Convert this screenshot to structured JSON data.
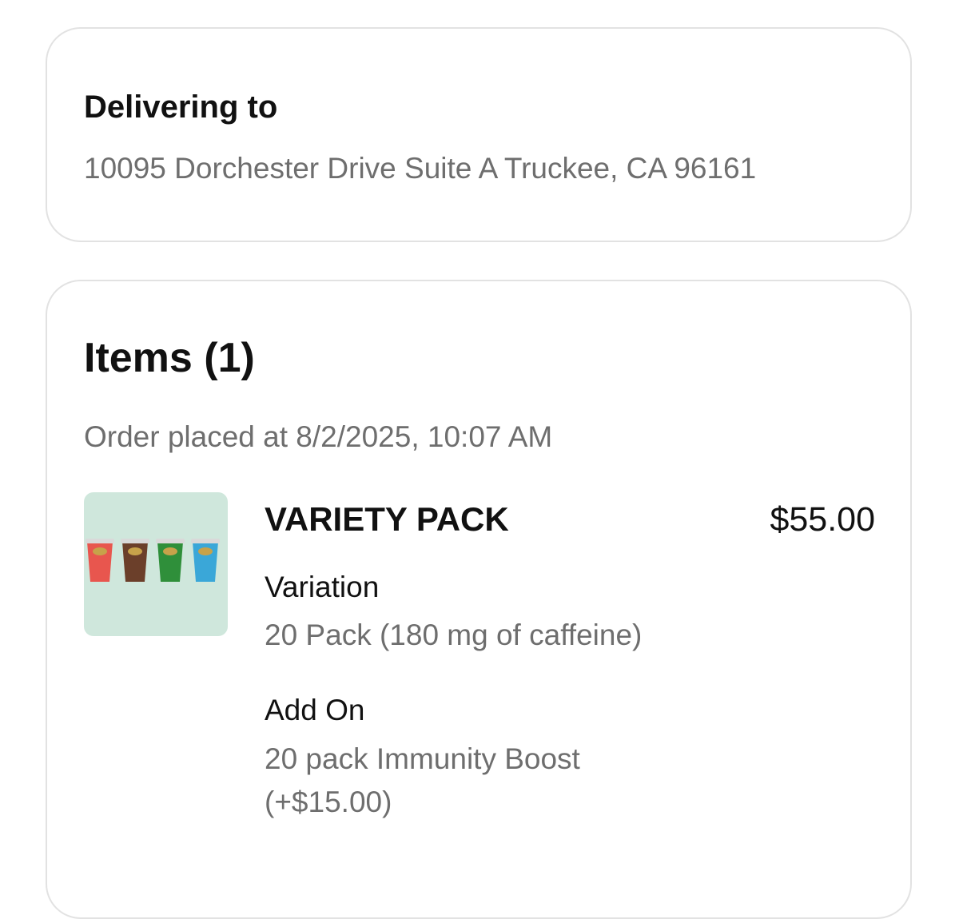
{
  "delivery": {
    "heading": "Delivering to",
    "address": "10095 Dorchester Drive Suite A Truckee, CA 96161"
  },
  "items": {
    "title": "Items (1)",
    "order_placed": "Order placed at 8/2/2025, 10:07 AM",
    "list": [
      {
        "name": "VARIETY PACK",
        "price": "$55.00",
        "image_icon": "drink-cups-image",
        "modifiers": [
          {
            "label": "Variation",
            "value": "20 Pack (180 mg of caffeine)"
          },
          {
            "label": "Add On",
            "value": "20 pack Immunity Boost (+$15.00)"
          }
        ]
      }
    ]
  },
  "colors": {
    "thumb_background": "#cfe7dc",
    "cup_red": "#e8564e",
    "cup_brown": "#6b3f2a",
    "cup_green": "#2f8f3a",
    "cup_blue": "#3aa7d8",
    "muted_text": "#6e6e6e"
  }
}
